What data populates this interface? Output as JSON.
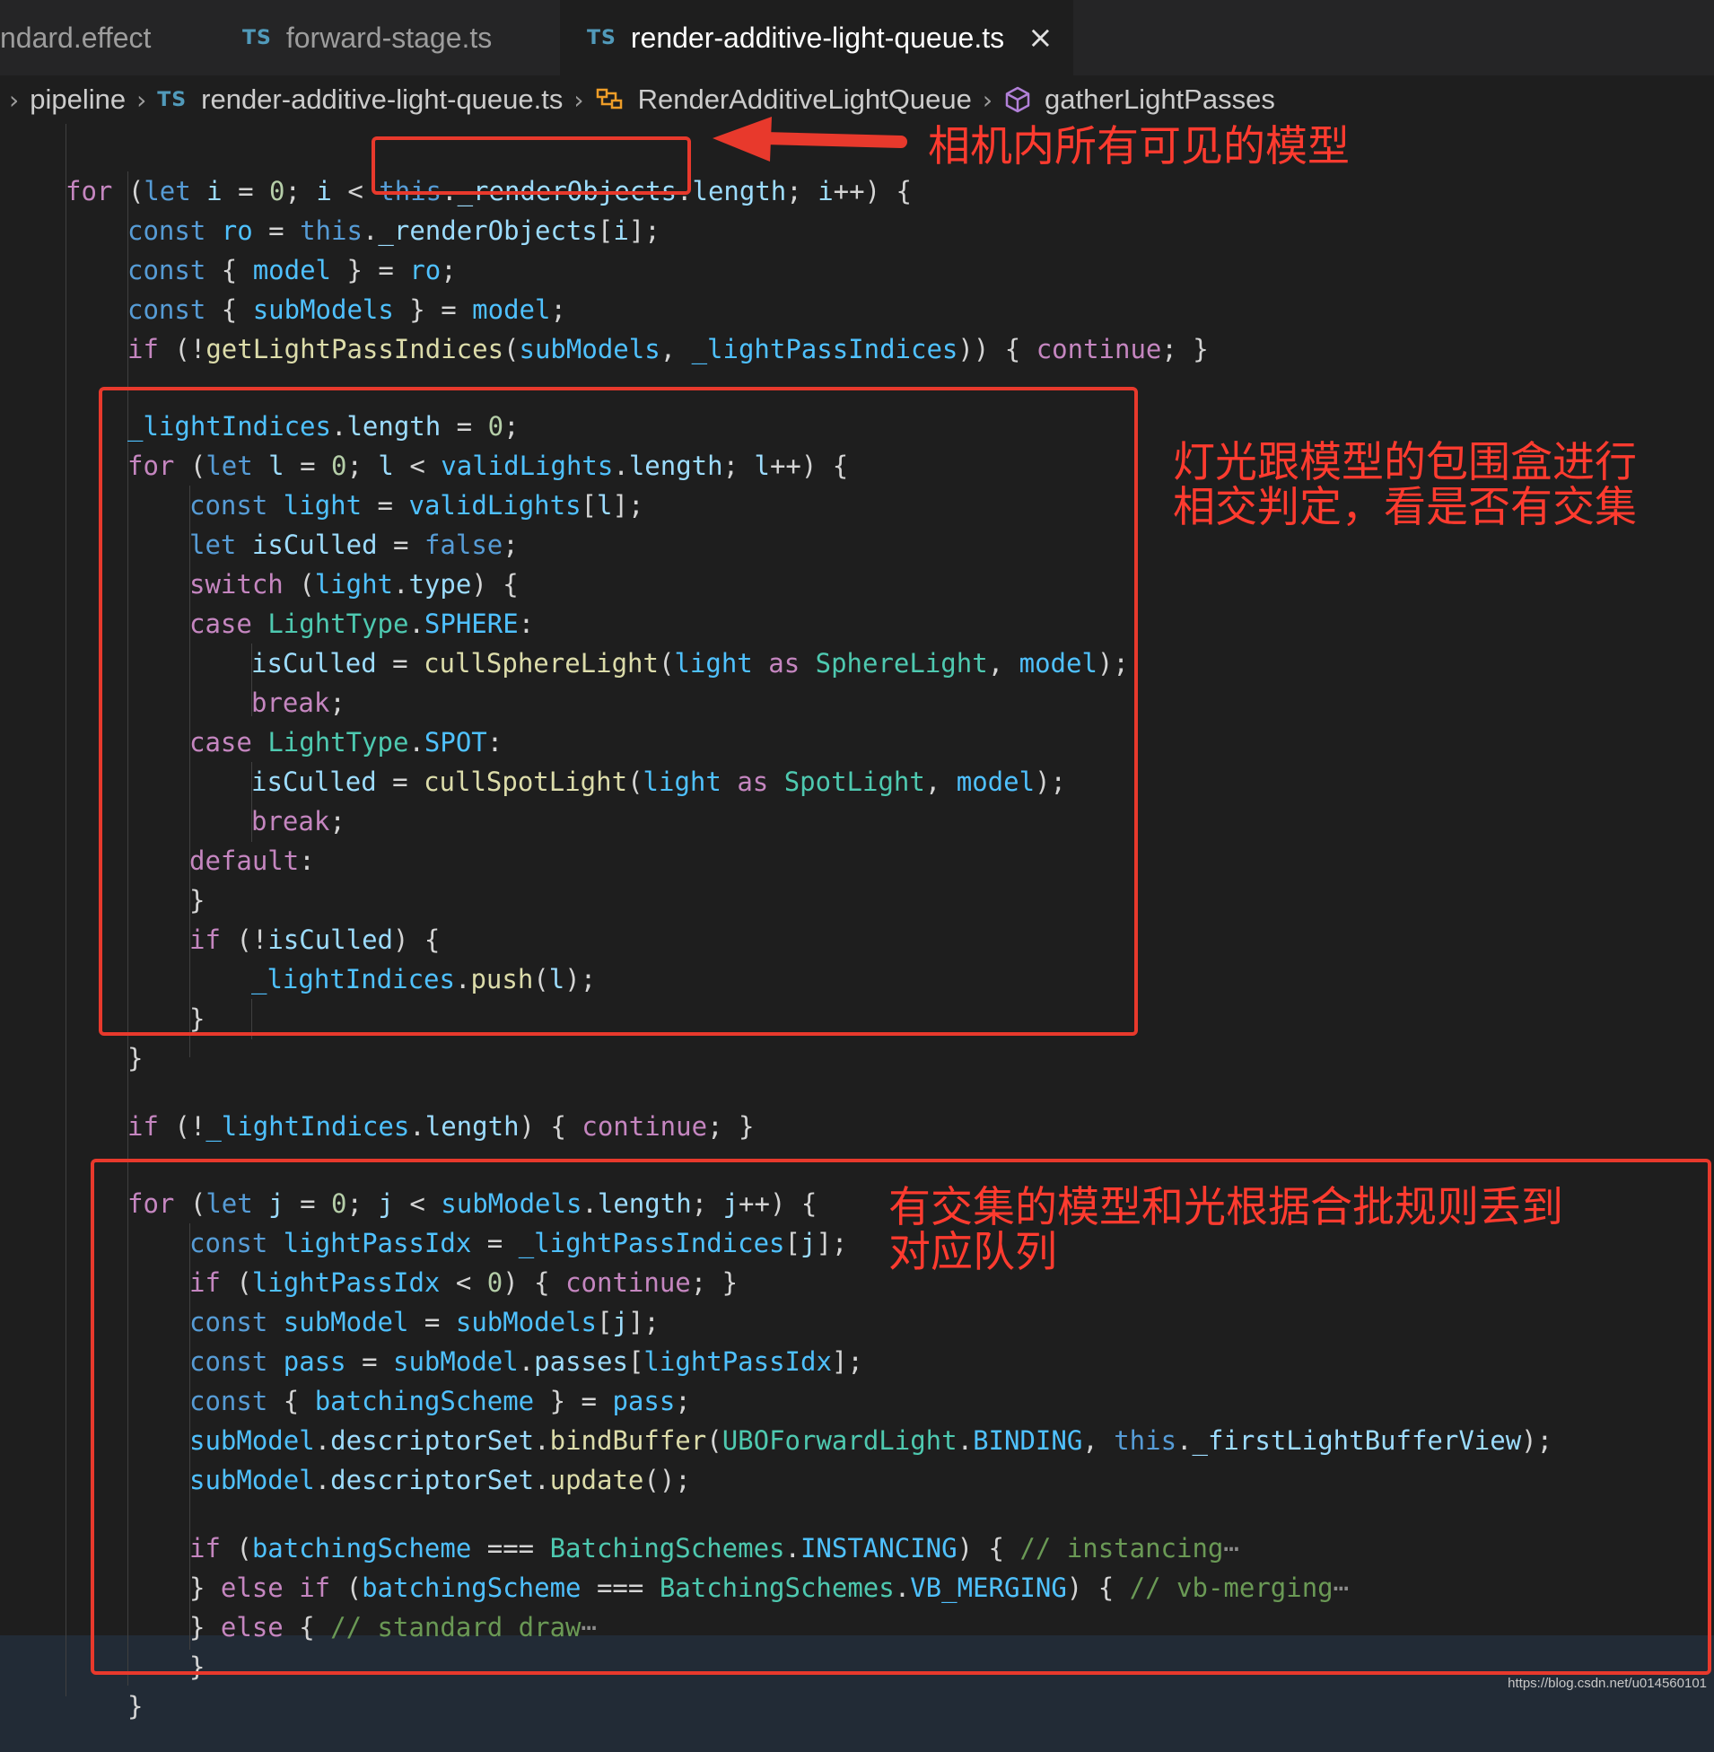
{
  "tabs": [
    {
      "badge": "",
      "label": "ndard.effect",
      "active": false
    },
    {
      "badge": "TS",
      "label": "forward-stage.ts",
      "active": false
    },
    {
      "badge": "TS",
      "label": "render-additive-light-queue.ts",
      "active": true,
      "close_icon": "×"
    }
  ],
  "breadcrumb": {
    "folder": "pipeline",
    "file_badge": "TS",
    "file": "render-additive-light-queue.ts",
    "class_name": "RenderAdditiveLightQueue",
    "method": "gatherLightPasses",
    "separator": "›"
  },
  "annotations": {
    "arrow_label": "相机内所有可见的模型",
    "box2_line1": "灯光跟模型的包围盒进行",
    "box2_line2": "相交判定，看是否有交集",
    "box3_line1": "有交集的模型和光根据合批规则丢到",
    "box3_line2": "对应队列"
  },
  "watermark": "https://blog.csdn.net/u014560101",
  "colors": {
    "background": "#1e1e1e",
    "annotation_red": "#e8392c",
    "keyword": "#569cd6",
    "control": "#c586c0",
    "function": "#dcdcaa",
    "type": "#4ec9b0",
    "comment": "#6a9955"
  },
  "code": {
    "lines": [
      [
        [
          "ctl",
          "for"
        ],
        [
          "pl",
          " ("
        ],
        [
          "kw",
          "let"
        ],
        [
          "pl",
          " "
        ],
        [
          "var",
          "i"
        ],
        [
          "pl",
          " = "
        ],
        [
          "num",
          "0"
        ],
        [
          "pl",
          "; "
        ],
        [
          "var",
          "i"
        ],
        [
          "pl",
          " < "
        ],
        [
          "kw",
          "this"
        ],
        [
          "pl",
          "."
        ],
        [
          "prop",
          "_renderObjects"
        ],
        [
          "pl",
          "."
        ],
        [
          "prop",
          "length"
        ],
        [
          "pl",
          "; "
        ],
        [
          "var",
          "i"
        ],
        [
          "pl",
          "++) {"
        ]
      ],
      [
        [
          "kw",
          "const"
        ],
        [
          "pl",
          " "
        ],
        [
          "prm",
          "ro"
        ],
        [
          "pl",
          " = "
        ],
        [
          "kw",
          "this"
        ],
        [
          "pl",
          "."
        ],
        [
          "prop",
          "_renderObjects"
        ],
        [
          "pl",
          "["
        ],
        [
          "var",
          "i"
        ],
        [
          "pl",
          "];"
        ]
      ],
      [
        [
          "kw",
          "const"
        ],
        [
          "pl",
          " { "
        ],
        [
          "prm",
          "model"
        ],
        [
          "pl",
          " } = "
        ],
        [
          "prm",
          "ro"
        ],
        [
          "pl",
          ";"
        ]
      ],
      [
        [
          "kw",
          "const"
        ],
        [
          "pl",
          " { "
        ],
        [
          "prm",
          "subModels"
        ],
        [
          "pl",
          " } = "
        ],
        [
          "prm",
          "model"
        ],
        [
          "pl",
          ";"
        ]
      ],
      [
        [
          "ctl",
          "if"
        ],
        [
          "pl",
          " (!"
        ],
        [
          "fn",
          "getLightPassIndices"
        ],
        [
          "pl",
          "("
        ],
        [
          "prm",
          "subModels"
        ],
        [
          "pl",
          ", "
        ],
        [
          "prm",
          "_lightPassIndices"
        ],
        [
          "pl",
          ")) { "
        ],
        [
          "ctl",
          "continue"
        ],
        [
          "pl",
          "; }"
        ]
      ],
      [],
      [
        [
          "prm",
          "_lightIndices"
        ],
        [
          "pl",
          "."
        ],
        [
          "prop",
          "length"
        ],
        [
          "pl",
          " = "
        ],
        [
          "num",
          "0"
        ],
        [
          "pl",
          ";"
        ]
      ],
      [
        [
          "ctl",
          "for"
        ],
        [
          "pl",
          " ("
        ],
        [
          "kw",
          "let"
        ],
        [
          "pl",
          " "
        ],
        [
          "var",
          "l"
        ],
        [
          "pl",
          " = "
        ],
        [
          "num",
          "0"
        ],
        [
          "pl",
          "; "
        ],
        [
          "var",
          "l"
        ],
        [
          "pl",
          " < "
        ],
        [
          "prm",
          "validLights"
        ],
        [
          "pl",
          "."
        ],
        [
          "prop",
          "length"
        ],
        [
          "pl",
          "; "
        ],
        [
          "var",
          "l"
        ],
        [
          "pl",
          "++) {"
        ]
      ],
      [
        [
          "kw",
          "const"
        ],
        [
          "pl",
          " "
        ],
        [
          "prm",
          "light"
        ],
        [
          "pl",
          " = "
        ],
        [
          "prm",
          "validLights"
        ],
        [
          "pl",
          "["
        ],
        [
          "var",
          "l"
        ],
        [
          "pl",
          "];"
        ]
      ],
      [
        [
          "kw",
          "let"
        ],
        [
          "pl",
          " "
        ],
        [
          "var",
          "isCulled"
        ],
        [
          "pl",
          " = "
        ],
        [
          "kw",
          "false"
        ],
        [
          "pl",
          ";"
        ]
      ],
      [
        [
          "ctl",
          "switch"
        ],
        [
          "pl",
          " ("
        ],
        [
          "prm",
          "light"
        ],
        [
          "pl",
          "."
        ],
        [
          "prop",
          "type"
        ],
        [
          "pl",
          ") {"
        ]
      ],
      [
        [
          "ctl",
          "case"
        ],
        [
          "pl",
          " "
        ],
        [
          "ty",
          "LightType"
        ],
        [
          "pl",
          "."
        ],
        [
          "prm",
          "SPHERE"
        ],
        [
          "pl",
          ":"
        ]
      ],
      [
        [
          "var",
          "isCulled"
        ],
        [
          "pl",
          " = "
        ],
        [
          "fn",
          "cullSphereLight"
        ],
        [
          "pl",
          "("
        ],
        [
          "prm",
          "light"
        ],
        [
          "pl",
          " "
        ],
        [
          "ctl",
          "as"
        ],
        [
          "pl",
          " "
        ],
        [
          "ty",
          "SphereLight"
        ],
        [
          "pl",
          ", "
        ],
        [
          "prm",
          "model"
        ],
        [
          "pl",
          ");"
        ]
      ],
      [
        [
          "ctl",
          "break"
        ],
        [
          "pl",
          ";"
        ]
      ],
      [
        [
          "ctl",
          "case"
        ],
        [
          "pl",
          " "
        ],
        [
          "ty",
          "LightType"
        ],
        [
          "pl",
          "."
        ],
        [
          "prm",
          "SPOT"
        ],
        [
          "pl",
          ":"
        ]
      ],
      [
        [
          "var",
          "isCulled"
        ],
        [
          "pl",
          " = "
        ],
        [
          "fn",
          "cullSpotLight"
        ],
        [
          "pl",
          "("
        ],
        [
          "prm",
          "light"
        ],
        [
          "pl",
          " "
        ],
        [
          "ctl",
          "as"
        ],
        [
          "pl",
          " "
        ],
        [
          "ty",
          "SpotLight"
        ],
        [
          "pl",
          ", "
        ],
        [
          "prm",
          "model"
        ],
        [
          "pl",
          ");"
        ]
      ],
      [
        [
          "ctl",
          "break"
        ],
        [
          "pl",
          ";"
        ]
      ],
      [
        [
          "ctl",
          "default"
        ],
        [
          "pl",
          ":"
        ]
      ],
      [
        [
          "pl",
          "}"
        ]
      ],
      [
        [
          "ctl",
          "if"
        ],
        [
          "pl",
          " (!"
        ],
        [
          "var",
          "isCulled"
        ],
        [
          "pl",
          ") {"
        ]
      ],
      [
        [
          "prm",
          "_lightIndices"
        ],
        [
          "pl",
          "."
        ],
        [
          "fn",
          "push"
        ],
        [
          "pl",
          "("
        ],
        [
          "var",
          "l"
        ],
        [
          "pl",
          ");"
        ]
      ],
      [
        [
          "pl",
          "}"
        ]
      ],
      [
        [
          "pl",
          "}"
        ]
      ],
      [],
      [
        [
          "ctl",
          "if"
        ],
        [
          "pl",
          " (!"
        ],
        [
          "prm",
          "_lightIndices"
        ],
        [
          "pl",
          "."
        ],
        [
          "prop",
          "length"
        ],
        [
          "pl",
          ") { "
        ],
        [
          "ctl",
          "continue"
        ],
        [
          "pl",
          "; }"
        ]
      ],
      [],
      [
        [
          "ctl",
          "for"
        ],
        [
          "pl",
          " ("
        ],
        [
          "kw",
          "let"
        ],
        [
          "pl",
          " "
        ],
        [
          "var",
          "j"
        ],
        [
          "pl",
          " = "
        ],
        [
          "num",
          "0"
        ],
        [
          "pl",
          "; "
        ],
        [
          "var",
          "j"
        ],
        [
          "pl",
          " < "
        ],
        [
          "prm",
          "subModels"
        ],
        [
          "pl",
          "."
        ],
        [
          "prop",
          "length"
        ],
        [
          "pl",
          "; "
        ],
        [
          "var",
          "j"
        ],
        [
          "pl",
          "++) {"
        ]
      ],
      [
        [
          "kw",
          "const"
        ],
        [
          "pl",
          " "
        ],
        [
          "prm",
          "lightPassIdx"
        ],
        [
          "pl",
          " = "
        ],
        [
          "prm",
          "_lightPassIndices"
        ],
        [
          "pl",
          "["
        ],
        [
          "var",
          "j"
        ],
        [
          "pl",
          "];"
        ]
      ],
      [
        [
          "ctl",
          "if"
        ],
        [
          "pl",
          " ("
        ],
        [
          "prm",
          "lightPassIdx"
        ],
        [
          "pl",
          " < "
        ],
        [
          "num",
          "0"
        ],
        [
          "pl",
          ") { "
        ],
        [
          "ctl",
          "continue"
        ],
        [
          "pl",
          "; }"
        ]
      ],
      [
        [
          "kw",
          "const"
        ],
        [
          "pl",
          " "
        ],
        [
          "prm",
          "subModel"
        ],
        [
          "pl",
          " = "
        ],
        [
          "prm",
          "subModels"
        ],
        [
          "pl",
          "["
        ],
        [
          "var",
          "j"
        ],
        [
          "pl",
          "];"
        ]
      ],
      [
        [
          "kw",
          "const"
        ],
        [
          "pl",
          " "
        ],
        [
          "prm",
          "pass"
        ],
        [
          "pl",
          " = "
        ],
        [
          "prm",
          "subModel"
        ],
        [
          "pl",
          "."
        ],
        [
          "prop",
          "passes"
        ],
        [
          "pl",
          "["
        ],
        [
          "prm",
          "lightPassIdx"
        ],
        [
          "pl",
          "];"
        ]
      ],
      [
        [
          "kw",
          "const"
        ],
        [
          "pl",
          " { "
        ],
        [
          "prm",
          "batchingScheme"
        ],
        [
          "pl",
          " } = "
        ],
        [
          "prm",
          "pass"
        ],
        [
          "pl",
          ";"
        ]
      ],
      [
        [
          "prm",
          "subModel"
        ],
        [
          "pl",
          "."
        ],
        [
          "prop",
          "descriptorSet"
        ],
        [
          "pl",
          "."
        ],
        [
          "fn",
          "bindBuffer"
        ],
        [
          "pl",
          "("
        ],
        [
          "ty",
          "UBOForwardLight"
        ],
        [
          "pl",
          "."
        ],
        [
          "prm",
          "BINDING"
        ],
        [
          "pl",
          ", "
        ],
        [
          "kw",
          "this"
        ],
        [
          "pl",
          "."
        ],
        [
          "prop",
          "_firstLightBufferView"
        ],
        [
          "pl",
          ");"
        ]
      ],
      [
        [
          "prm",
          "subModel"
        ],
        [
          "pl",
          "."
        ],
        [
          "prop",
          "descriptorSet"
        ],
        [
          "pl",
          "."
        ],
        [
          "fn",
          "update"
        ],
        [
          "pl",
          "();"
        ]
      ],
      [],
      [
        [
          "ctl",
          "if"
        ],
        [
          "pl",
          " ("
        ],
        [
          "prm",
          "batchingScheme"
        ],
        [
          "pl",
          " === "
        ],
        [
          "ty",
          "BatchingSchemes"
        ],
        [
          "pl",
          "."
        ],
        [
          "prm",
          "INSTANCING"
        ],
        [
          "pl",
          ") { "
        ],
        [
          "cm",
          "// instancing"
        ],
        [
          "ell",
          "⋯"
        ]
      ],
      [
        [
          "pl",
          "} "
        ],
        [
          "ctl",
          "else if"
        ],
        [
          "pl",
          " ("
        ],
        [
          "prm",
          "batchingScheme"
        ],
        [
          "pl",
          " === "
        ],
        [
          "ty",
          "BatchingSchemes"
        ],
        [
          "pl",
          "."
        ],
        [
          "prm",
          "VB_MERGING"
        ],
        [
          "pl",
          ") { "
        ],
        [
          "cm",
          "// vb-merging"
        ],
        [
          "ell",
          "⋯"
        ]
      ],
      [
        [
          "pl",
          "} "
        ],
        [
          "ctl",
          "else"
        ],
        [
          "pl",
          " { "
        ],
        [
          "cm",
          "// standard draw"
        ],
        [
          "ell",
          "⋯"
        ]
      ],
      [
        [
          "pl",
          "}"
        ]
      ],
      [
        [
          "pl",
          "}"
        ]
      ]
    ]
  }
}
